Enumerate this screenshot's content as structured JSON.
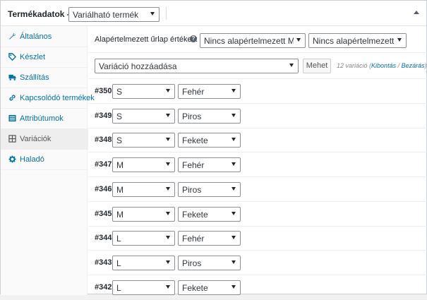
{
  "header": {
    "title": "Termékadatok —",
    "product_type": "Variálható termék"
  },
  "sidebar": {
    "items": [
      {
        "label": "Általános",
        "icon": "wrench-icon"
      },
      {
        "label": "Készlet",
        "icon": "tag-icon"
      },
      {
        "label": "Szállítás",
        "icon": "truck-icon"
      },
      {
        "label": "Kapcsolódó termékek",
        "icon": "link-icon"
      },
      {
        "label": "Attribútumok",
        "icon": "list-icon"
      },
      {
        "label": "Variációk",
        "icon": "grid-icon"
      },
      {
        "label": "Haladó",
        "icon": "gear-icon"
      }
    ],
    "active_index": 5
  },
  "defaults": {
    "label": "Alapértelmezett űrlap értékek:",
    "size_select": "Nincs alapértelmezett Méret...",
    "color_select": "Nincs alapértelmezett Szín..."
  },
  "add": {
    "select": "Variáció hozzáadása",
    "button": "Mehet",
    "count": "12 variáció",
    "expand": "Kibontás",
    "separator": " / ",
    "close": "Bezárás",
    "open_paren": "(",
    "close_paren": ")"
  },
  "variations": [
    {
      "id": "#350",
      "size": "S",
      "color": "Fehér"
    },
    {
      "id": "#349",
      "size": "S",
      "color": "Piros"
    },
    {
      "id": "#348",
      "size": "S",
      "color": "Fekete"
    },
    {
      "id": "#347",
      "size": "M",
      "color": "Fehér"
    },
    {
      "id": "#346",
      "size": "M",
      "color": "Piros"
    },
    {
      "id": "#345",
      "size": "M",
      "color": "Fekete"
    },
    {
      "id": "#344",
      "size": "L",
      "color": "Fehér"
    },
    {
      "id": "#343",
      "size": "L",
      "color": "Piros"
    },
    {
      "id": "#342",
      "size": "L",
      "color": "Fekete"
    }
  ],
  "colors": {
    "link": "#0073aa",
    "active_tab_bg": "#eeeeee"
  }
}
